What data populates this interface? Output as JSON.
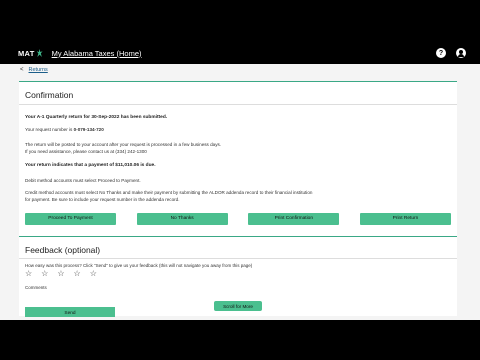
{
  "header": {
    "logo_text": "MAT",
    "site_link": "My Alabama Taxes (Home)",
    "help_icon_glyph": "?",
    "icons": [
      "help-icon",
      "user-icon"
    ]
  },
  "breadcrumb": {
    "chevron": "<",
    "label": "Returns"
  },
  "confirmation": {
    "title": "Confirmation",
    "submitted": "Your A-1 Quarterly return for 30-Sep-2022 has been submitted.",
    "request_prefix": "Your request number is ",
    "request_number": "0-079-134-720",
    "posted_line1": "The return will be posted to your account after your request is processed in a few business days.",
    "posted_line2": "If you need assistance, please contact us at (334) 242-1300",
    "payment_due": "Your return indicates that a payment of $11,010.06 is due.",
    "debit_note": "Debit method accounts must select Proceed to Payment.",
    "credit_note1": "Credit method accounts must select No Thanks and make their payment by submitting the ALDOR addenda record to their financial institution",
    "credit_note2": "for payment. Be sure to include your request number in the addenda record.",
    "buttons": {
      "proceed": "Proceed To Payment",
      "no_thanks": "No Thanks",
      "print_confirmation": "Print Confirmation",
      "print_return": "Print Return"
    }
  },
  "feedback": {
    "title": "Feedback (optional)",
    "question": "How easy was this process? Click \"Send\" to give us your feedback (this will not navigate you away from this page)",
    "star_glyph": "☆",
    "comments_label": "Comments",
    "send_label": "Send"
  },
  "scroll_label": "Scroll for More",
  "colors": {
    "accent": "#4bbf8f",
    "header_bg": "#000000",
    "link": "#1b5e8a"
  }
}
